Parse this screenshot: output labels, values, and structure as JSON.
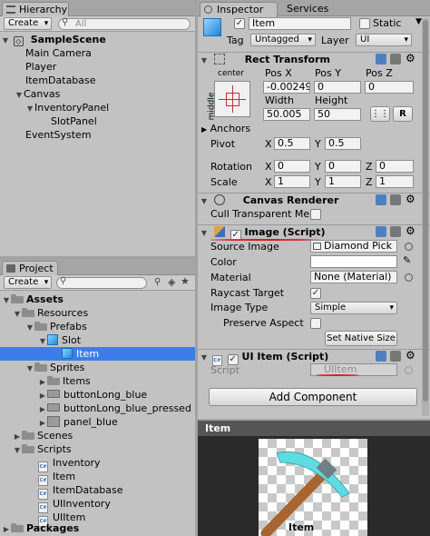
{
  "hierarchy": {
    "tab": "Hierarchy",
    "create": "Create",
    "search_placeholder": "All",
    "scene": "SampleScene",
    "items": [
      "Main Camera",
      "Player",
      "ItemDatabase",
      "Canvas",
      "InventoryPanel",
      "SlotPanel",
      "EventSystem"
    ]
  },
  "project": {
    "tab": "Project",
    "create": "Create",
    "tree": {
      "assets": "Assets",
      "resources": "Resources",
      "prefabs": "Prefabs",
      "slot": "Slot",
      "item": "Item",
      "sprites": "Sprites",
      "items": "Items",
      "button_long_blue": "buttonLong_blue",
      "button_long_blue_pressed": "buttonLong_blue_pressed",
      "panel_blue": "panel_blue",
      "scenes": "Scenes",
      "scripts": "Scripts",
      "inventory": "Inventory",
      "item_script": "Item",
      "item_database": "ItemDatabase",
      "ui_inventory": "UIInventory",
      "ui_item": "UIItem",
      "packages": "Packages"
    }
  },
  "inspector": {
    "tab": "Inspector",
    "tab2": "Services",
    "object_name": "Item",
    "static_label": "Static",
    "tag_label": "Tag",
    "tag_value": "Untagged",
    "layer_label": "Layer",
    "layer_value": "UI",
    "rect": {
      "title": "Rect Transform",
      "anchor_h": "center",
      "anchor_v": "middle",
      "pos_x_label": "Pos X",
      "pos_y_label": "Pos Y",
      "pos_z_label": "Pos Z",
      "pos_x": "-0.00249",
      "pos_y": "0",
      "pos_z": "0",
      "width_label": "Width",
      "height_label": "Height",
      "width": "50.005",
      "height": "50",
      "r_label": "R",
      "anchors_label": "Anchors",
      "pivot_label": "Pivot",
      "pivot_x": "0.5",
      "pivot_y": "0.5",
      "rotation_label": "Rotation",
      "rot_x": "0",
      "rot_y": "0",
      "rot_z": "0",
      "scale_label": "Scale",
      "scale_x": "1",
      "scale_y": "1",
      "scale_z": "1",
      "x": "X",
      "y": "Y",
      "z": "Z"
    },
    "canvas_renderer": {
      "title": "Canvas Renderer",
      "cull_label": "Cull Transparent Me"
    },
    "image": {
      "title": "Image (Script)",
      "source_label": "Source Image",
      "source_value": "Diamond Pick",
      "color_label": "Color",
      "material_label": "Material",
      "material_value": "None (Material)",
      "raycast_label": "Raycast Target",
      "image_type_label": "Image Type",
      "image_type_value": "Simple",
      "preserve_label": "Preserve Aspect",
      "native_button": "Set Native Size"
    },
    "ui_item": {
      "title": "UI Item (Script)",
      "script_label": "Script",
      "script_value": "UIItem"
    },
    "add_component": "Add Component"
  },
  "preview": {
    "title": "Item",
    "caption": "Item"
  },
  "colors": {
    "selection": "#3e7de7",
    "panel": "#c2c2c2",
    "annotation": "#d42020"
  }
}
